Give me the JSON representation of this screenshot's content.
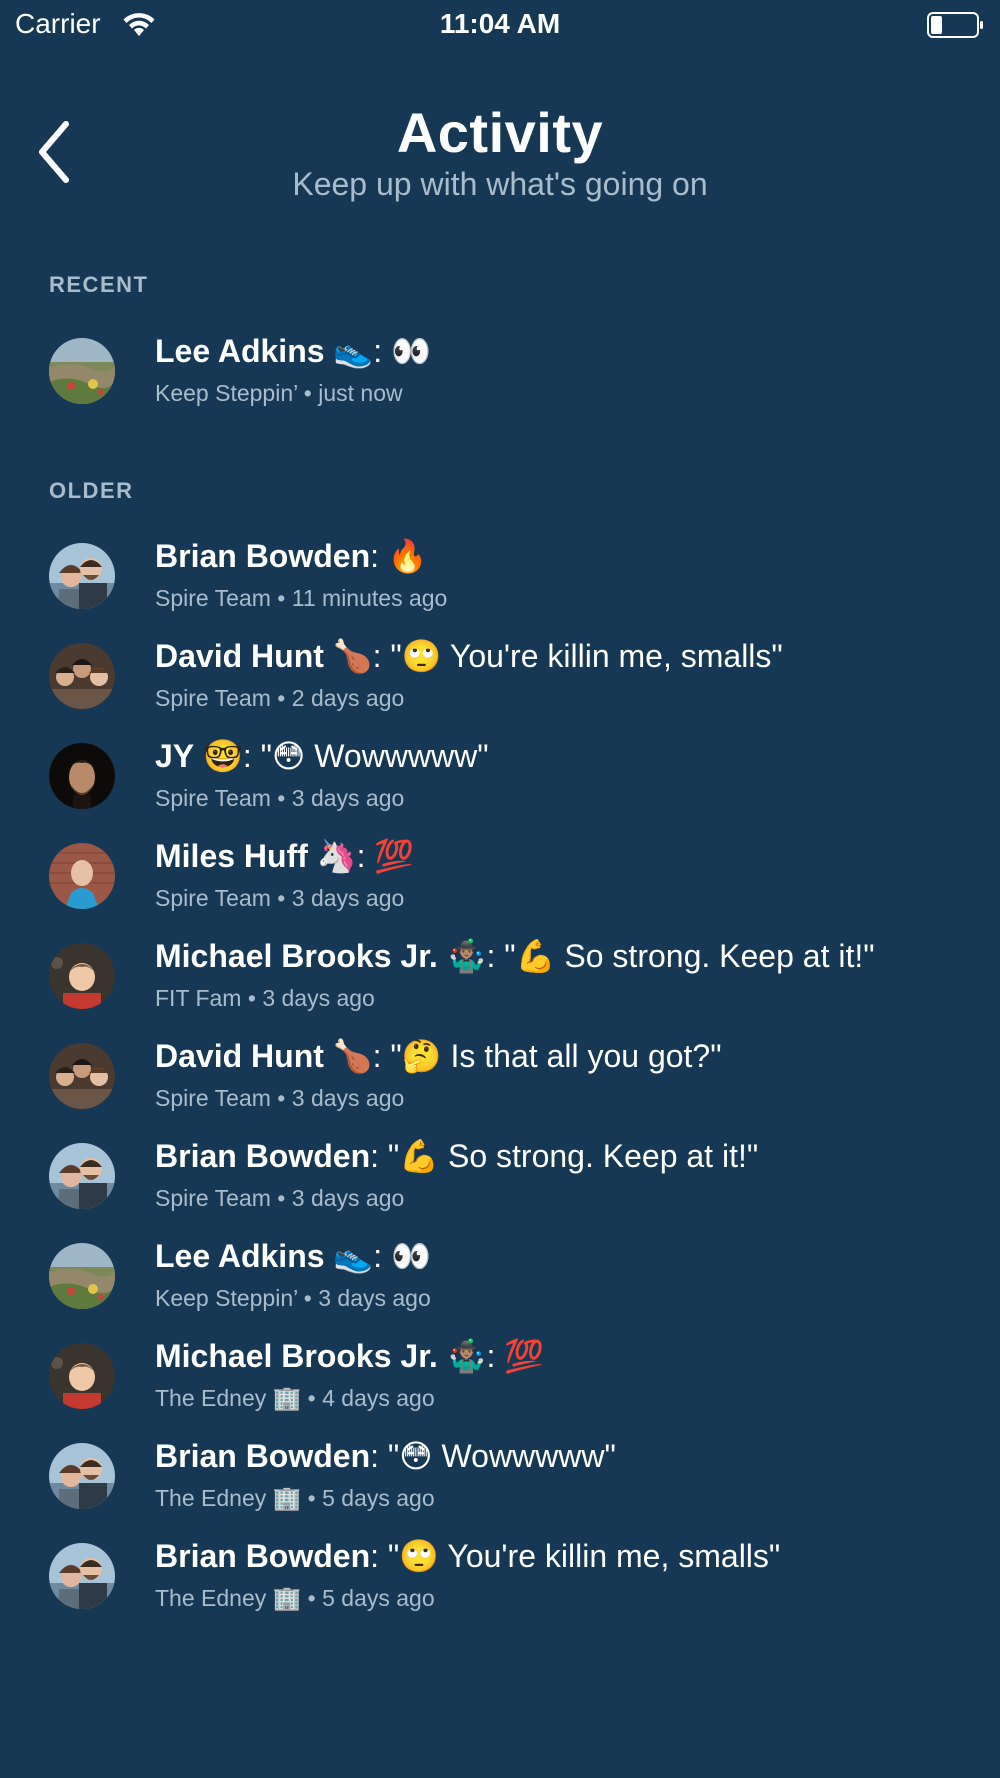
{
  "status_bar": {
    "carrier": "Carrier",
    "time": "11:04 AM"
  },
  "header": {
    "title": "Activity",
    "subtitle": "Keep up with what's going on"
  },
  "sections": {
    "recent_label": "RECENT",
    "older_label": "OLDER"
  },
  "recent": [
    {
      "name": "Lee Adkins",
      "name_emoji": "👟",
      "separator": ": ",
      "message": "👀",
      "group": "Keep Steppin’",
      "time": "just now",
      "avatar": "landscape"
    }
  ],
  "older": [
    {
      "name": "Brian Bowden",
      "name_emoji": "",
      "separator": ": ",
      "message": "🔥",
      "group": "Spire Team",
      "time": "11 minutes ago",
      "avatar": "couple"
    },
    {
      "name": "David Hunt",
      "name_emoji": "🍗",
      "separator": ": ",
      "message": "\"🙄 You're killin me, smalls\"",
      "group": "Spire Team",
      "time": "2 days ago",
      "avatar": "group"
    },
    {
      "name": "JY",
      "name_emoji": "🤓",
      "separator": ": ",
      "message": "\"😳 Wowwwww\"",
      "group": "Spire Team",
      "time": "3 days ago",
      "avatar": "dark"
    },
    {
      "name": "Miles Huff",
      "name_emoji": "🦄",
      "separator": ": ",
      "message": "💯",
      "group": "Spire Team",
      "time": "3 days ago",
      "avatar": "brick"
    },
    {
      "name": "Michael Brooks Jr.",
      "name_emoji": "🤹🏽‍♂️",
      "separator": ": ",
      "message": "\"💪 So strong. Keep at it!\"",
      "group": "FIT Fam",
      "time": "3 days ago",
      "avatar": "kid"
    },
    {
      "name": "David Hunt",
      "name_emoji": "🍗",
      "separator": ": ",
      "message": "\"🤔 Is that all you got?\"",
      "group": "Spire Team",
      "time": "3 days ago",
      "avatar": "group"
    },
    {
      "name": "Brian Bowden",
      "name_emoji": "",
      "separator": ": ",
      "message": "\"💪 So strong. Keep at it!\"",
      "group": "Spire Team",
      "time": "3 days ago",
      "avatar": "couple"
    },
    {
      "name": "Lee Adkins",
      "name_emoji": "👟",
      "separator": ": ",
      "message": "👀",
      "group": "Keep Steppin’",
      "time": "3 days ago",
      "avatar": "landscape"
    },
    {
      "name": "Michael Brooks Jr.",
      "name_emoji": "🤹🏽‍♂️",
      "separator": ": ",
      "message": "💯",
      "group": "The Edney 🏢",
      "time": "4 days ago",
      "avatar": "kid"
    },
    {
      "name": "Brian Bowden",
      "name_emoji": "",
      "separator": ": ",
      "message": "\"😳 Wowwwww\"",
      "group": "The Edney 🏢",
      "time": "5 days ago",
      "avatar": "couple"
    },
    {
      "name": "Brian Bowden",
      "name_emoji": "",
      "separator": ": ",
      "message": "\"🙄 You're killin me, smalls\"",
      "group": "The Edney 🏢",
      "time": "5 days ago",
      "avatar": "couple"
    }
  ],
  "colors": {
    "background": "#173854",
    "primary_text": "#ffffff",
    "secondary_text": "#a9bccc"
  }
}
